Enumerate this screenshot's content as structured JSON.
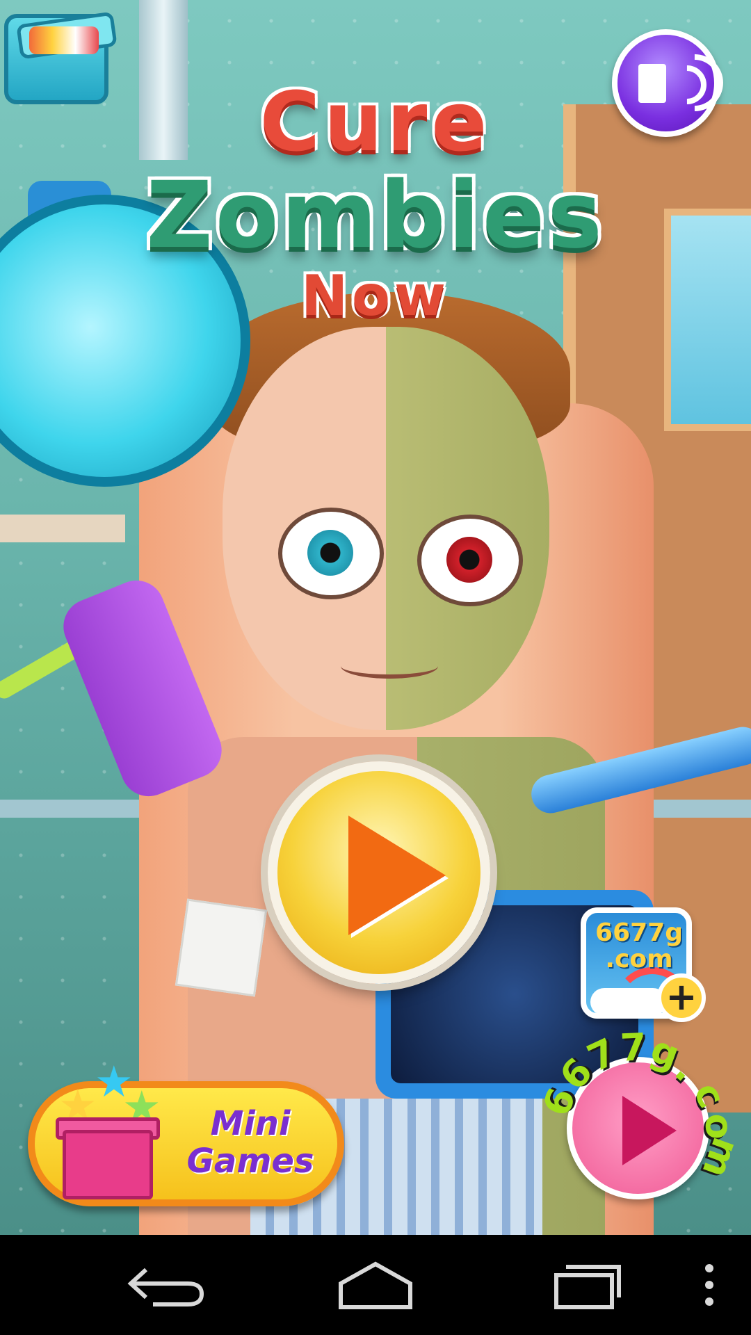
{
  "game": {
    "title": {
      "line1": "Cure",
      "line2": "Zombies",
      "line3": "Now"
    }
  },
  "buttons": {
    "minigames_label": "Mini\nGames",
    "logo_text": "6677g\n.com",
    "plus": "+",
    "site_ring": "6677g.com"
  },
  "icons": {
    "toybox": "toybox-icon",
    "sound": "speaker-icon",
    "play": "play-icon",
    "gift": "gift-icon",
    "site_play": "play-icon"
  },
  "colors": {
    "title_red": "#e84b3a",
    "title_green": "#2f9c73",
    "play_orange": "#f26a12",
    "sound_purple": "#7a2fe0",
    "minigames_yellow": "#ffe94a"
  }
}
